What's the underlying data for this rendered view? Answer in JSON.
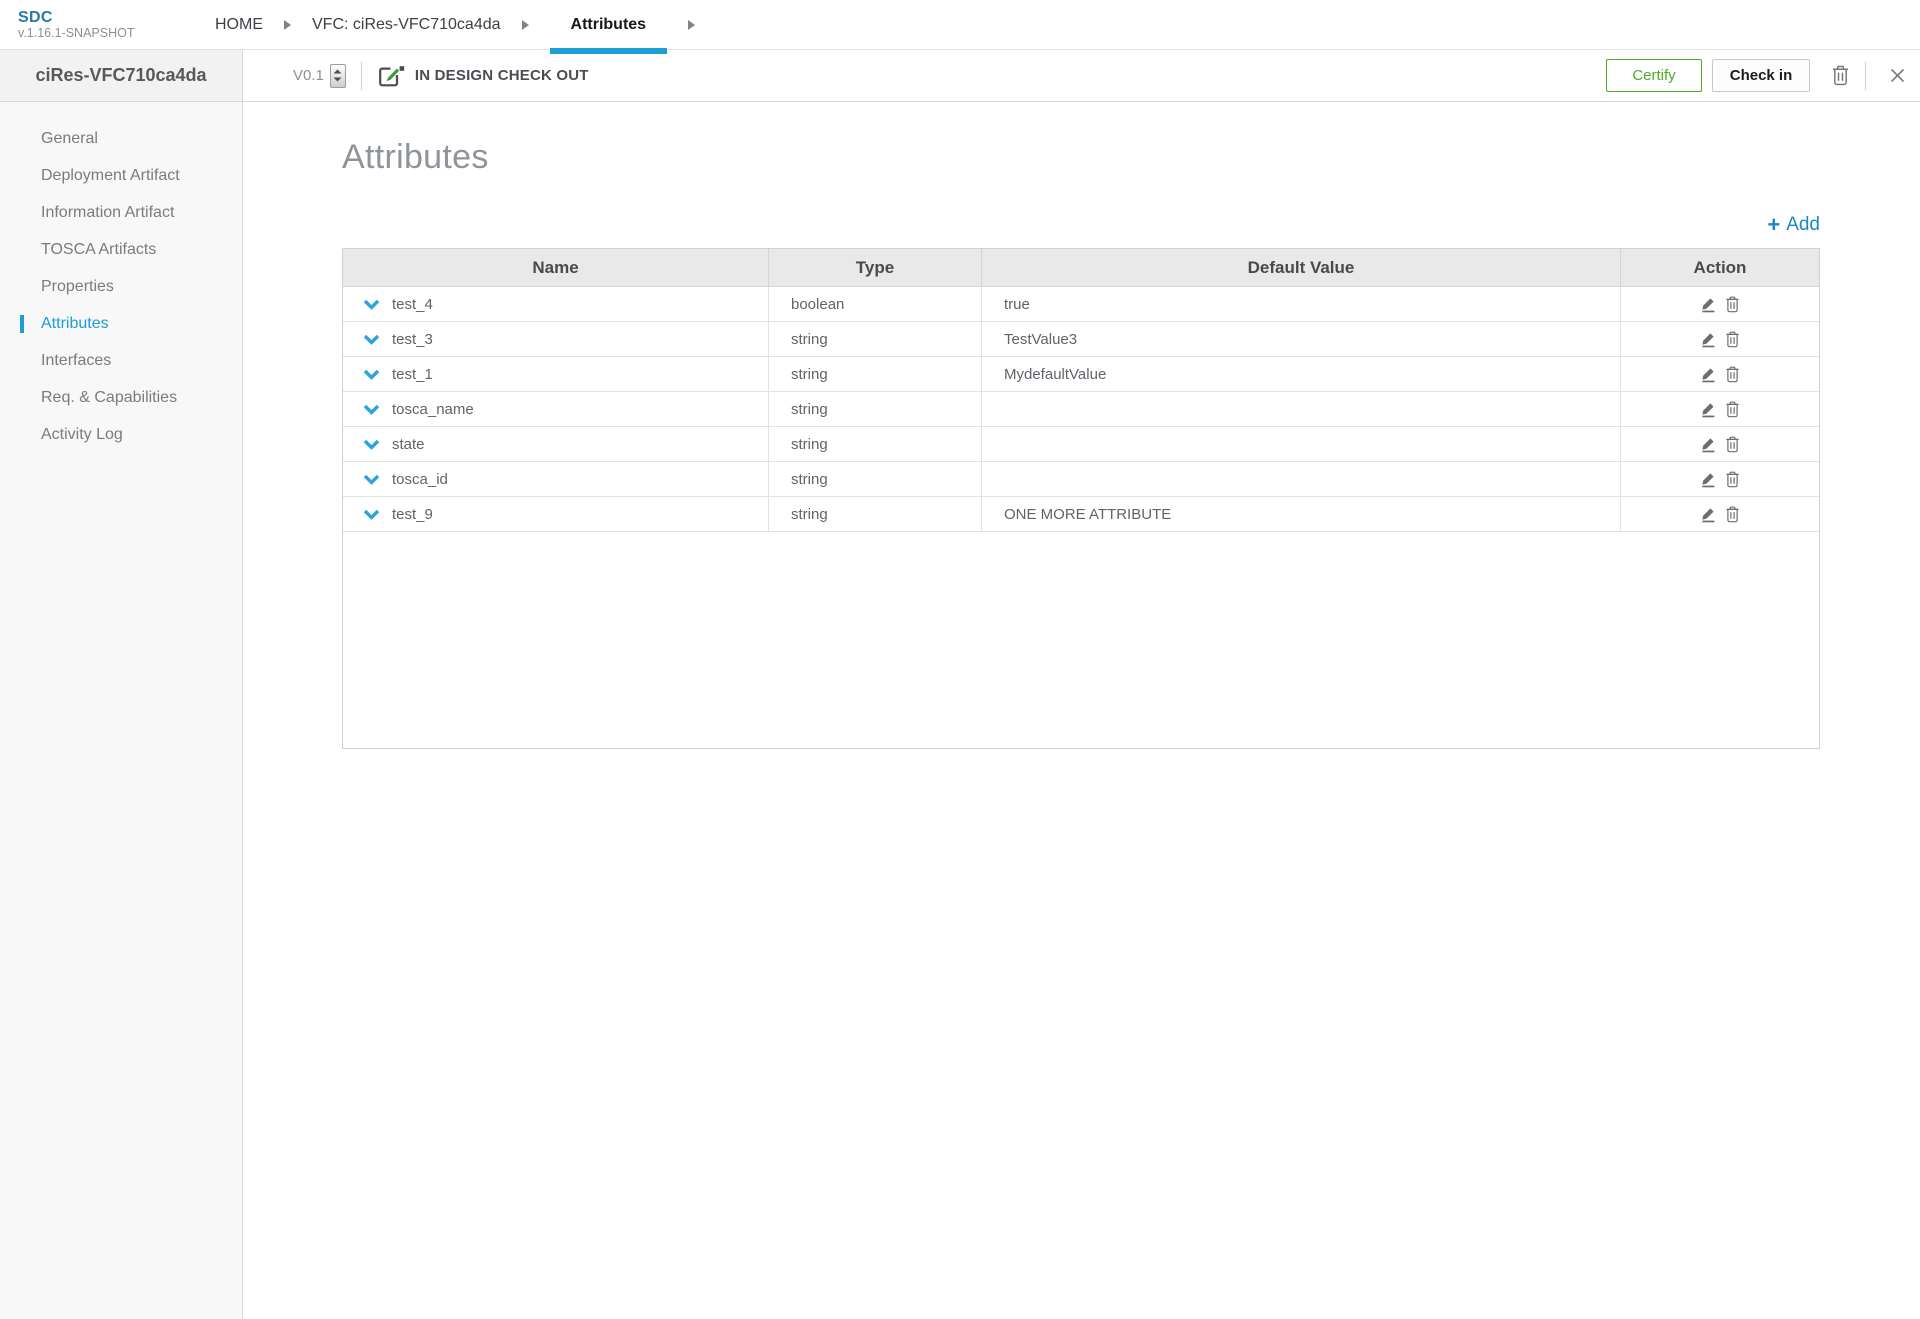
{
  "app": {
    "logo": "SDC",
    "build_version": "v.1.16.1-SNAPSHOT"
  },
  "breadcrumbs": [
    {
      "label": "HOME",
      "active": false
    },
    {
      "label": "VFC: ciRes-VFC710ca4da",
      "active": false
    },
    {
      "label": "Attributes",
      "active": true
    }
  ],
  "workspace": {
    "entity_name": "ciRes-VFC710ca4da",
    "version_label": "V0.1",
    "lifecycle_status": "IN DESIGN CHECK OUT",
    "certify_label": "Certify",
    "check_in_label": "Check in"
  },
  "sidebar": {
    "items": [
      {
        "label": "General",
        "active": false
      },
      {
        "label": "Deployment Artifact",
        "active": false
      },
      {
        "label": "Information Artifact",
        "active": false
      },
      {
        "label": "TOSCA Artifacts",
        "active": false
      },
      {
        "label": "Properties",
        "active": false
      },
      {
        "label": "Attributes",
        "active": true
      },
      {
        "label": "Interfaces",
        "active": false
      },
      {
        "label": "Req. & Capabilities",
        "active": false
      },
      {
        "label": "Activity Log",
        "active": false
      }
    ]
  },
  "main": {
    "title": "Attributes",
    "add_plus": "+",
    "add_label": "Add",
    "table": {
      "columns": [
        "Name",
        "Type",
        "Default Value",
        "Action"
      ],
      "rows": [
        {
          "name": "test_4",
          "type": "boolean",
          "default_value": "true"
        },
        {
          "name": "test_3",
          "type": "string",
          "default_value": "TestValue3"
        },
        {
          "name": "test_1",
          "type": "string",
          "default_value": "MydefaultValue"
        },
        {
          "name": "tosca_name",
          "type": "string",
          "default_value": ""
        },
        {
          "name": "state",
          "type": "string",
          "default_value": ""
        },
        {
          "name": "tosca_id",
          "type": "string",
          "default_value": ""
        },
        {
          "name": "test_9",
          "type": "string",
          "default_value": "ONE MORE ATTRIBUTE"
        }
      ]
    }
  },
  "icons": {
    "breadcrumb_separator": "right-triangle",
    "version_spinner": "up-down-arrows",
    "checkout_state": "square-with-green-pencil",
    "delete": "trash",
    "close": "x",
    "expand_row": "chevron-down",
    "edit_row": "pencil-underline",
    "delete_row": "trash"
  },
  "colors": {
    "accent_blue": "#1e9ed6",
    "link_blue": "#1d87c9",
    "logo_blue": "#2878ab",
    "certify_green": "#4faa25",
    "pencil_green": "#3c9b35"
  }
}
